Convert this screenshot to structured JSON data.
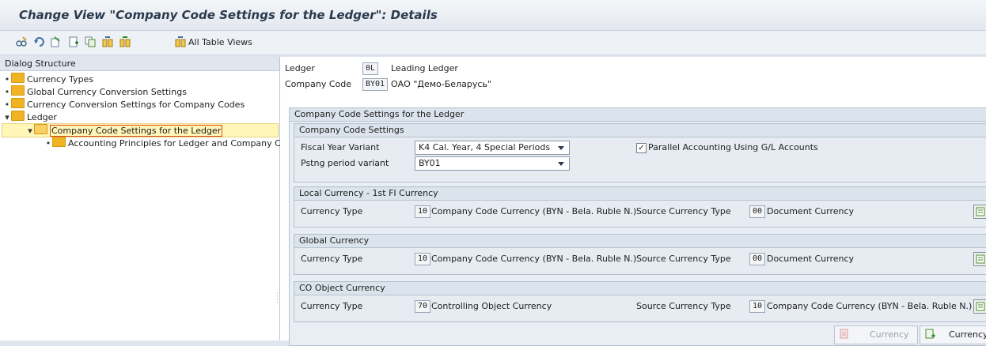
{
  "window": {
    "title": "Change View \"Company Code Settings for the Ledger\": Details"
  },
  "toolbar": {
    "icons": [
      "edit-glasses-icon",
      "undo-icon",
      "other-entry-icon",
      "new-entries-icon",
      "copy-as-icon",
      "select-all-icon",
      "table-views-icon"
    ],
    "all_table_views": "All Table Views"
  },
  "dialog_structure": {
    "header": "Dialog Structure",
    "items": [
      {
        "label": "Currency Types",
        "level": 0
      },
      {
        "label": "Global Currency Conversion Settings",
        "level": 0
      },
      {
        "label": "Currency Conversion Settings for Company Codes",
        "level": 0
      },
      {
        "label": "Ledger",
        "level": 0,
        "expanded": true
      },
      {
        "label": "Company Code Settings for the Ledger",
        "level": 1,
        "expanded": true,
        "selected": true
      },
      {
        "label": "Accounting Principles for Ledger and Company Code",
        "level": 2
      }
    ]
  },
  "header": {
    "ledger_label": "Ledger",
    "ledger_code": "0L",
    "ledger_name": "Leading Ledger",
    "company_label": "Company Code",
    "company_code": "BY01",
    "company_name": "ОАО \"Демо-Беларусь\""
  },
  "settings": {
    "group_title": "Company Code Settings for the Ledger",
    "cc_settings": {
      "title": "Company Code Settings",
      "fiscal_year_label": "Fiscal Year Variant",
      "fiscal_year_value": "K4 Cal. Year, 4 Special Periods",
      "posting_period_label": "Pstng period variant",
      "posting_period_value": "BY01",
      "parallel_accounting_label": "Parallel Accounting Using G/L Accounts",
      "parallel_accounting_checked": true,
      "check_mark": "✓"
    },
    "local_currency": {
      "title": "Local Currency - 1st FI Currency",
      "currency_type_label": "Currency Type",
      "currency_type_code": "10",
      "currency_type_text": "Company Code Currency (BYN - Bela. Ruble N.)",
      "source_label": "Source Currency Type",
      "source_code": "00",
      "source_text": "Document Currency"
    },
    "global_currency": {
      "title": "Global Currency",
      "currency_type_label": "Currency Type",
      "currency_type_code": "10",
      "currency_type_text": "Company Code Currency (BYN - Bela. Ruble N.)",
      "source_label": "Source Currency Type",
      "source_code": "00",
      "source_text": "Document Currency"
    },
    "co_object_currency": {
      "title": "CO Object Currency",
      "currency_type_label": "Currency Type",
      "currency_type_code": "70",
      "currency_type_text": "Controlling Object Currency",
      "source_label": "Source Currency Type",
      "source_code": "10",
      "source_text": "Company Code Currency (BYN - Bela. Ruble N.)"
    }
  },
  "footer_buttons": {
    "currency_disabled": "Currency",
    "currency_enabled": "Currency"
  },
  "colors": {
    "accent_folder": "#f0b323",
    "selection": "#fff6b8",
    "title_text": "#2a3a4e"
  }
}
